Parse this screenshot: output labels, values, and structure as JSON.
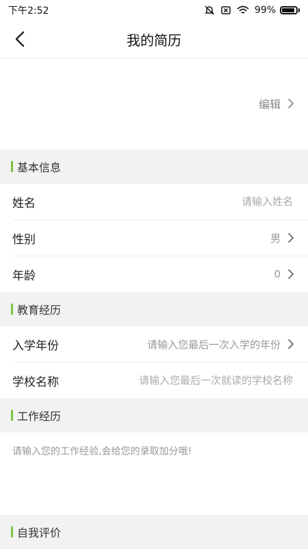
{
  "status_bar": {
    "time": "下午2:52",
    "battery": "99%",
    "battery_level": 0.99,
    "icons": [
      "mute-alarm-icon",
      "sim-x-icon",
      "wifi-icon",
      "battery-icon"
    ]
  },
  "nav": {
    "back_icon": "chevron-left-icon",
    "title": "我的简历"
  },
  "header": {
    "edit_label": "编辑",
    "edit_icon": "chevron-right-icon"
  },
  "sections": {
    "basic": {
      "title": "基本信息",
      "name_label": "姓名",
      "name_placeholder": "请输入姓名",
      "gender_label": "性别",
      "gender_value": "男",
      "age_label": "年龄",
      "age_value": "0"
    },
    "education": {
      "title": "教育经历",
      "year_label": "入学年份",
      "year_placeholder": "请输入您最后一次入学的年份",
      "school_label": "学校名称",
      "school_placeholder": "请输入您最后一次就读的学校名称"
    },
    "work": {
      "title": "工作经历",
      "placeholder": "请输入您的工作经验,会给您的录取加分哦!"
    },
    "self_eval": {
      "title": "自我评价"
    }
  },
  "colors": {
    "accent": "#7cc242",
    "section_bg": "#f2f2f2"
  }
}
